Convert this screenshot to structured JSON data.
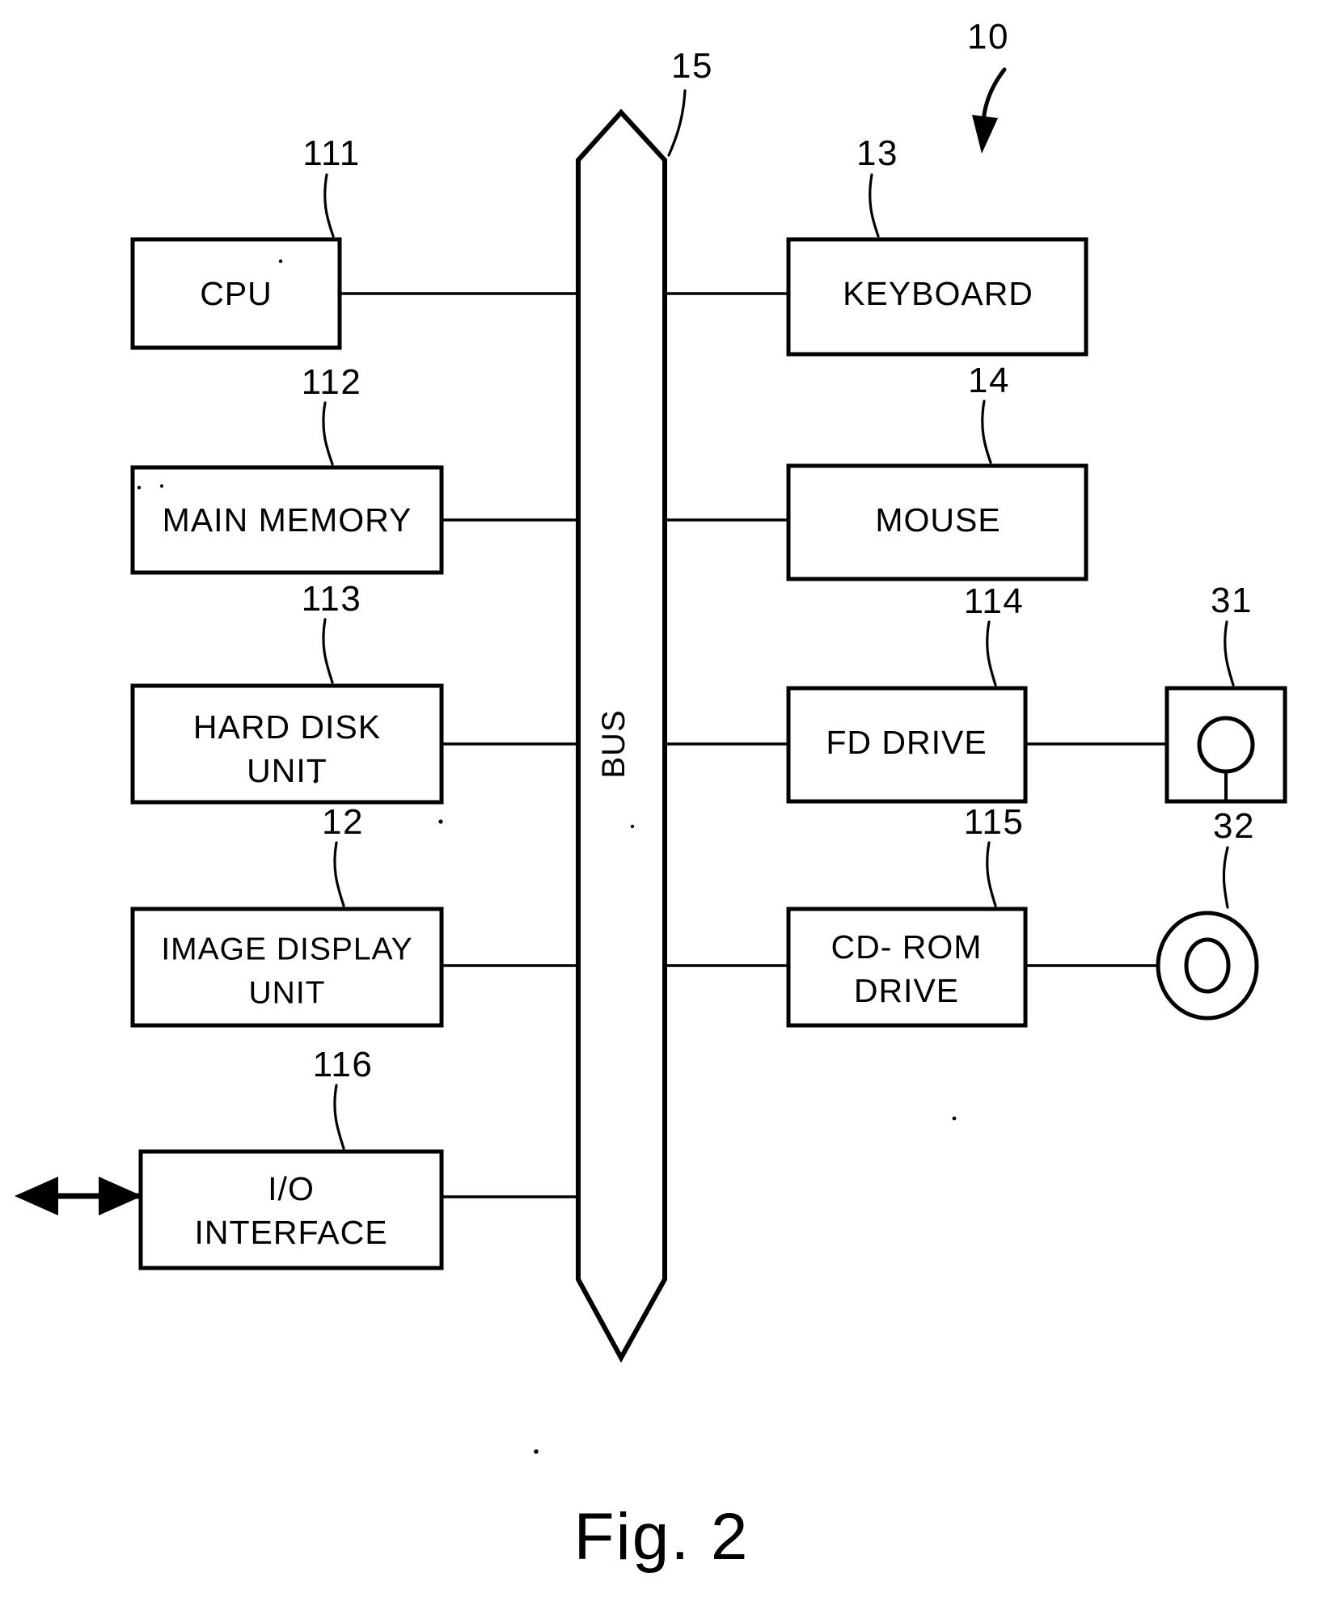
{
  "figure": {
    "caption": "Fig. 2",
    "system_ref": "10",
    "bus_ref": "15",
    "bus_label": "BUS"
  },
  "left_column": [
    {
      "label": "CPU",
      "ref": "111",
      "lines": [
        "CPU"
      ]
    },
    {
      "label": "MAIN MEMORY",
      "ref": "112",
      "lines": [
        "MAIN MEMORY"
      ]
    },
    {
      "label": "HARD DISK UNIT",
      "ref": "113",
      "lines": [
        "HARD DISK",
        "UNIT"
      ]
    },
    {
      "label": "IMAGE DISPLAY UNIT",
      "ref": "12",
      "lines": [
        "IMAGE DISPLAY",
        "UNIT"
      ]
    },
    {
      "label": "I/O INTERFACE",
      "ref": "116",
      "lines": [
        "I/O",
        "INTERFACE"
      ]
    }
  ],
  "right_column": [
    {
      "label": "KEYBOARD",
      "ref": "13",
      "lines": [
        "KEYBOARD"
      ]
    },
    {
      "label": "MOUSE",
      "ref": "14",
      "lines": [
        "MOUSE"
      ]
    },
    {
      "label": "FD DRIVE",
      "ref": "114",
      "lines": [
        "FD DRIVE"
      ]
    },
    {
      "label": "CD- ROM DRIVE",
      "ref": "115",
      "lines": [
        "CD- ROM",
        "DRIVE"
      ]
    }
  ],
  "media": [
    {
      "name": "floppy-disk",
      "ref": "31"
    },
    {
      "name": "cd-rom-disc",
      "ref": "32"
    }
  ],
  "icons": {
    "external_io_arrow": "double-headed-arrow",
    "system_pointer": "curved-down-arrow"
  },
  "text": {
    "cpu": "CPU",
    "main_memory": "MAIN MEMORY",
    "hard_disk_1": "HARD DISK",
    "hard_disk_2": "UNIT",
    "image_display_1": "IMAGE DISPLAY",
    "image_display_2": "UNIT",
    "io_1": "I/O",
    "io_2": "INTERFACE",
    "keyboard": "KEYBOARD",
    "mouse": "MOUSE",
    "fd_drive": "FD DRIVE",
    "cdrom_1": "CD- ROM",
    "cdrom_2": "DRIVE",
    "bus": "BUS",
    "ref_111": "111",
    "ref_112": "112",
    "ref_113": "113",
    "ref_12": "12",
    "ref_116": "116",
    "ref_13": "13",
    "ref_14": "14",
    "ref_114": "114",
    "ref_115": "115",
    "ref_31": "31",
    "ref_32": "32",
    "ref_15": "15",
    "ref_10": "10",
    "caption": "Fig. 2"
  }
}
